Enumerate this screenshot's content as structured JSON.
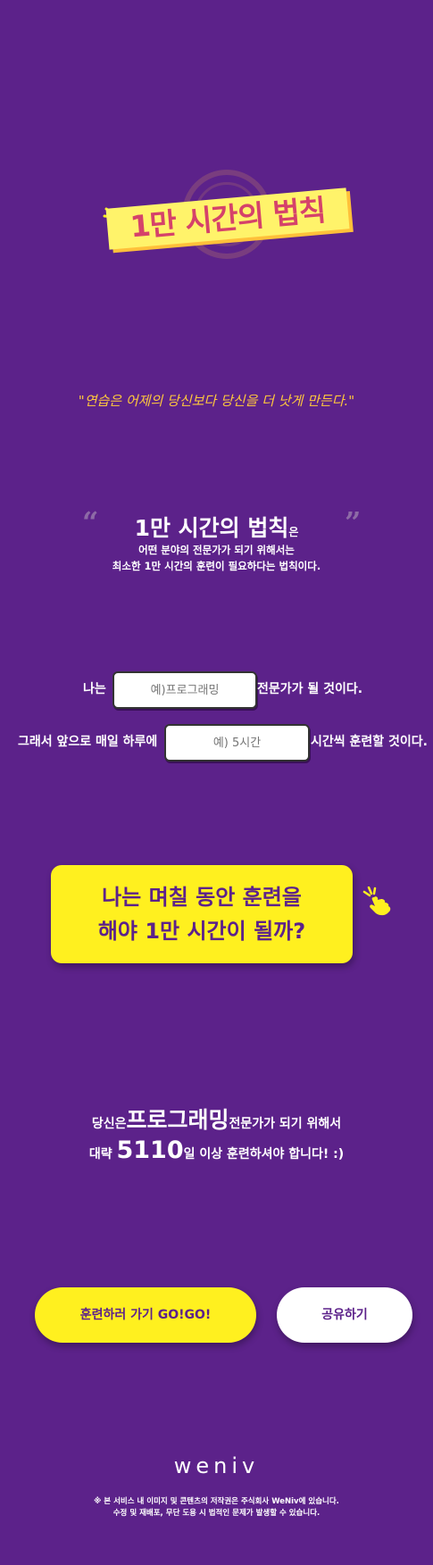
{
  "logo": {
    "title": "1만 시간의 법칙"
  },
  "quote": "\"연습은 어제의 당신보다 당신을 더 낫게 만든다.\"",
  "rule": {
    "open_quote": "“",
    "close_quote": "”",
    "title": "1만 시간의 법칙",
    "title_suffix": "은",
    "desc_line1": "어떤 분야의 전문가가 되기 위해서는",
    "desc_line2": "최소한 1만 시간의 훈련이 필요하다는 법칙이다."
  },
  "form": {
    "row1_prefix": "나는",
    "field_placeholder": "예)프로그래밍",
    "row1_suffix": "전문가가 될 것이다.",
    "row2_prefix": "그래서 앞으로 매일 하루에",
    "time_placeholder": "예) 5시간",
    "row2_suffix": "시간씩 훈련할 것이다."
  },
  "cta": {
    "line1": "나는 며칠 동안 훈련을",
    "line2": "해야 1만 시간이 될까?"
  },
  "result": {
    "prefix": "당신은",
    "field": "프로그래밍",
    "suffix": "전문가가 되기 위해서",
    "approx": "대략",
    "days": "5110",
    "days_suffix": "일 이상 훈련하셔야 합니다! :)"
  },
  "buttons": {
    "go": "훈련하러 가기 GO!GO!",
    "share": "공유하기"
  },
  "footer": {
    "brand": "weniv",
    "copyright_line1": "※ 본 서비스 내 이미지 및 콘텐츠의 저작권은 주식회사 WeNiv에 있습니다.",
    "copyright_line2": "수정 및 재배포, 무단 도용 시 법적인 문제가 발생할 수 있습니다."
  },
  "colors": {
    "background": "#5c228a",
    "accent_yellow": "#fff01f",
    "quote_gold": "#ffc83d",
    "logo_pink": "#d5426a"
  }
}
